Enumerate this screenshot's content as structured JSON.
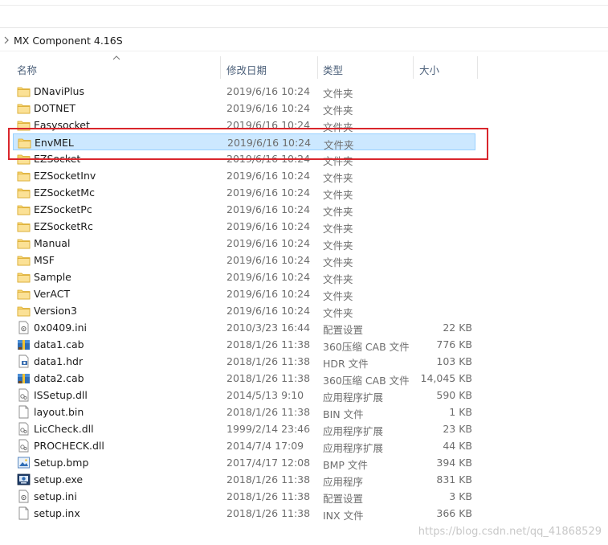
{
  "breadcrumb": {
    "path": "MX Component 4.16S"
  },
  "columns": {
    "name": "名称",
    "date": "修改日期",
    "type": "类型",
    "size": "大小"
  },
  "files": [
    {
      "name": "DNaviPlus",
      "date": "2019/6/16 10:24",
      "type": "文件夹",
      "size": "",
      "icon": "folder-icon"
    },
    {
      "name": "DOTNET",
      "date": "2019/6/16 10:24",
      "type": "文件夹",
      "size": "",
      "icon": "folder-icon"
    },
    {
      "name": "Easysocket",
      "date": "2019/6/16 10:24",
      "type": "文件夹",
      "size": "",
      "icon": "folder-icon"
    },
    {
      "name": "EnvMEL",
      "date": "2019/6/16 10:24",
      "type": "文件夹",
      "size": "",
      "icon": "folder-icon",
      "selected": true
    },
    {
      "name": "EZSocket",
      "date": "2019/6/16 10:24",
      "type": "文件夹",
      "size": "",
      "icon": "folder-icon"
    },
    {
      "name": "EZSocketInv",
      "date": "2019/6/16 10:24",
      "type": "文件夹",
      "size": "",
      "icon": "folder-icon"
    },
    {
      "name": "EZSocketMc",
      "date": "2019/6/16 10:24",
      "type": "文件夹",
      "size": "",
      "icon": "folder-icon"
    },
    {
      "name": "EZSocketPc",
      "date": "2019/6/16 10:24",
      "type": "文件夹",
      "size": "",
      "icon": "folder-icon"
    },
    {
      "name": "EZSocketRc",
      "date": "2019/6/16 10:24",
      "type": "文件夹",
      "size": "",
      "icon": "folder-icon"
    },
    {
      "name": "Manual",
      "date": "2019/6/16 10:24",
      "type": "文件夹",
      "size": "",
      "icon": "folder-icon"
    },
    {
      "name": "MSF",
      "date": "2019/6/16 10:24",
      "type": "文件夹",
      "size": "",
      "icon": "folder-icon"
    },
    {
      "name": "Sample",
      "date": "2019/6/16 10:24",
      "type": "文件夹",
      "size": "",
      "icon": "folder-icon"
    },
    {
      "name": "VerACT",
      "date": "2019/6/16 10:24",
      "type": "文件夹",
      "size": "",
      "icon": "folder-icon"
    },
    {
      "name": "Version3",
      "date": "2019/6/16 10:24",
      "type": "文件夹",
      "size": "",
      "icon": "folder-icon"
    },
    {
      "name": "0x0409.ini",
      "date": "2010/3/23 16:44",
      "type": "配置设置",
      "size": "22 KB",
      "icon": "settings-file-icon"
    },
    {
      "name": "data1.cab",
      "date": "2018/1/26 11:38",
      "type": "360压缩 CAB 文件",
      "size": "776 KB",
      "icon": "archive-file-icon"
    },
    {
      "name": "data1.hdr",
      "date": "2018/1/26 11:38",
      "type": "HDR 文件",
      "size": "103 KB",
      "icon": "hdr-file-icon"
    },
    {
      "name": "data2.cab",
      "date": "2018/1/26 11:38",
      "type": "360压缩 CAB 文件",
      "size": "14,045 KB",
      "icon": "archive-file-icon"
    },
    {
      "name": "ISSetup.dll",
      "date": "2014/5/13 9:10",
      "type": "应用程序扩展",
      "size": "590 KB",
      "icon": "dll-file-icon"
    },
    {
      "name": "layout.bin",
      "date": "2018/1/26 11:38",
      "type": "BIN 文件",
      "size": "1 KB",
      "icon": "blank-file-icon"
    },
    {
      "name": "LicCheck.dll",
      "date": "1999/2/14 23:46",
      "type": "应用程序扩展",
      "size": "23 KB",
      "icon": "dll-file-icon"
    },
    {
      "name": "PROCHECK.dll",
      "date": "2014/7/4 17:09",
      "type": "应用程序扩展",
      "size": "44 KB",
      "icon": "dll-file-icon"
    },
    {
      "name": "Setup.bmp",
      "date": "2017/4/17 12:08",
      "type": "BMP 文件",
      "size": "394 KB",
      "icon": "image-file-icon"
    },
    {
      "name": "setup.exe",
      "date": "2018/1/26 11:38",
      "type": "应用程序",
      "size": "831 KB",
      "icon": "installer-exe-icon"
    },
    {
      "name": "setup.ini",
      "date": "2018/1/26 11:38",
      "type": "配置设置",
      "size": "3 KB",
      "icon": "settings-file-icon"
    },
    {
      "name": "setup.inx",
      "date": "2018/1/26 11:38",
      "type": "INX 文件",
      "size": "366 KB",
      "icon": "blank-file-icon"
    }
  ],
  "watermark": "https://blog.csdn.net/qq_41868529",
  "colors": {
    "selection_bg": "#cce8ff",
    "selection_border": "#99d1ff",
    "annotation_box": "#d9262c",
    "folder": "#f8d775"
  }
}
